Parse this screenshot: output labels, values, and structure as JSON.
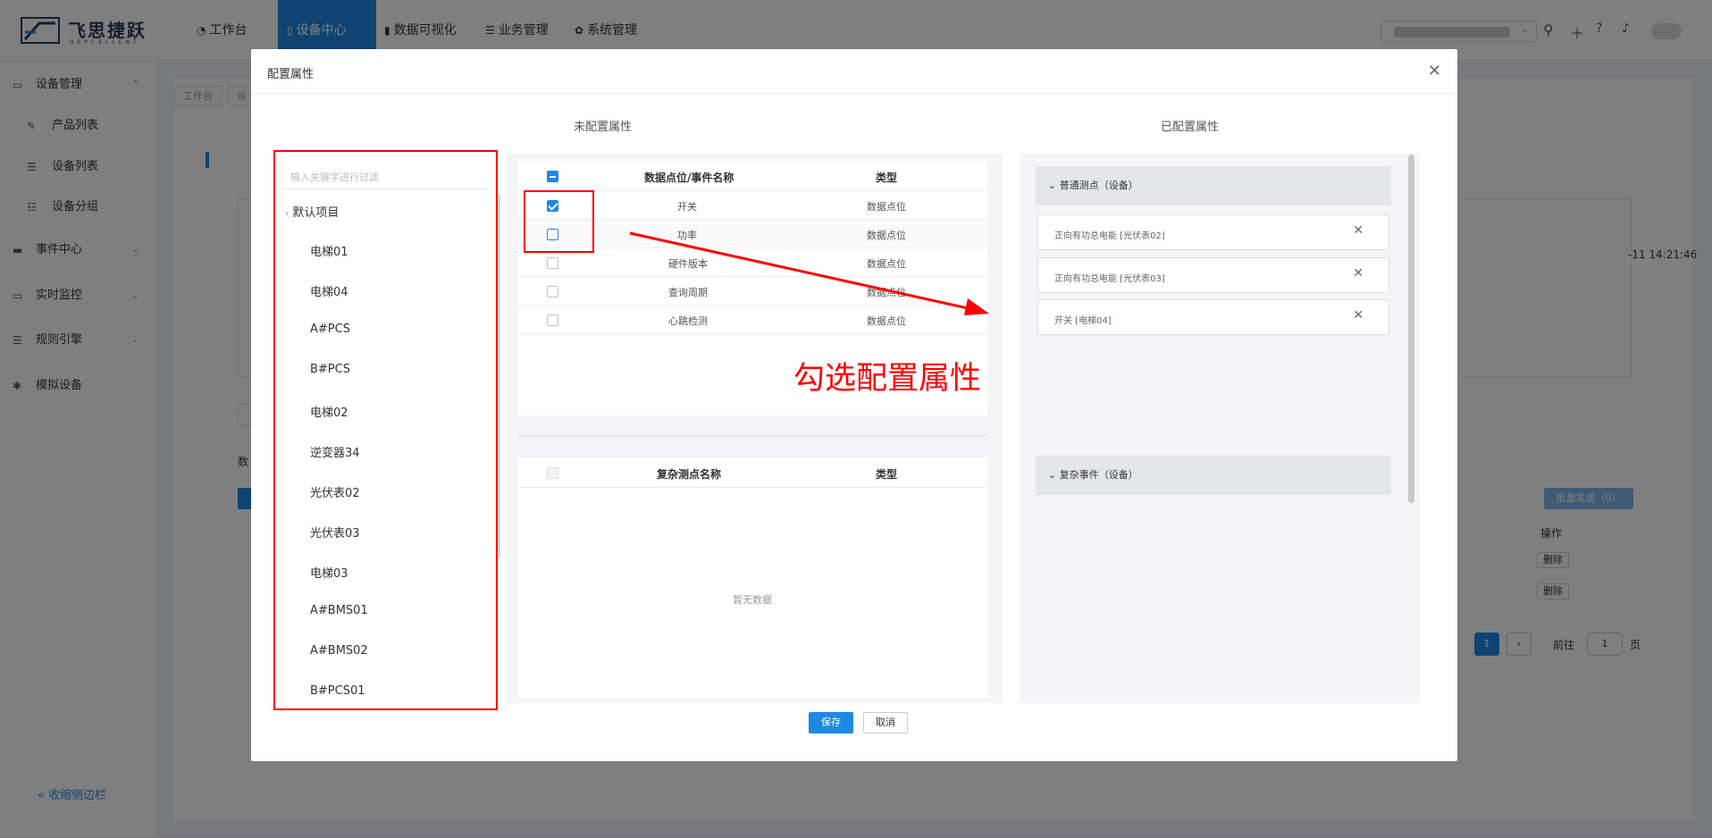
{
  "app": {
    "logo_name": "飞思捷跃",
    "logo_sub": "DEPCELLENT",
    "nav": [
      {
        "label": "工作台",
        "icon": "dashboard-icon"
      },
      {
        "label": "设备中心",
        "icon": "device-icon"
      },
      {
        "label": "数据可视化",
        "icon": "chart-icon"
      },
      {
        "label": "业务管理",
        "icon": "list-icon"
      },
      {
        "label": "系统管理",
        "icon": "gear-icon"
      }
    ],
    "active_nav": "设备中心"
  },
  "sidebar": {
    "items": [
      {
        "label": "设备管理",
        "icon": "monitor-icon",
        "arrow": "⌃"
      },
      {
        "label": "产品列表",
        "icon": "edit-icon"
      },
      {
        "label": "设备列表",
        "icon": "list-icon"
      },
      {
        "label": "设备分组",
        "icon": "group-icon"
      },
      {
        "label": "事件中心",
        "icon": "message-icon",
        "arrow": "⌄"
      },
      {
        "label": "实时监控",
        "icon": "monitor-icon",
        "arrow": "⌄"
      },
      {
        "label": "规则引擎",
        "icon": "rule-icon",
        "arrow": "⌄"
      },
      {
        "label": "模拟设备",
        "icon": "bug-icon"
      }
    ],
    "collapse_label": "收缩侧边栏"
  },
  "background": {
    "tab1": "工作台",
    "tab2": "设",
    "timestamp": "-11 14:21:46",
    "tab_partial": "数",
    "batch_send": "批量发送（0）",
    "ops_header": "操作",
    "delete1": "删除",
    "delete2": "删除",
    "page_current": "1",
    "goto_label": "前往",
    "goto_value": "1",
    "page_suffix": "页"
  },
  "dialog": {
    "title": "配置属性",
    "unconfigured_title": "未配置属性",
    "configured_title": "已配置属性",
    "search_placeholder": "输入关键字进行过滤",
    "tree_root": "默认项目",
    "tree_items": [
      "电梯01",
      "电梯04",
      "A#PCS",
      "B#PCS",
      "电梯02",
      "逆变器34",
      "光伏表02",
      "光伏表03",
      "电梯03",
      "A#BMS01",
      "A#BMS02",
      "B#PCS01"
    ],
    "table1": {
      "headers": [
        "数据点位/事件名称",
        "类型"
      ],
      "rows": [
        {
          "name": "开关",
          "type": "数据点位",
          "checked": true
        },
        {
          "name": "功率",
          "type": "数据点位",
          "checked": false
        },
        {
          "name": "硬件版本",
          "type": "数据点位",
          "checked": false
        },
        {
          "name": "查询周期",
          "type": "数据点位",
          "checked": false
        },
        {
          "name": "心跳检测",
          "type": "数据点位",
          "checked": false
        }
      ]
    },
    "table2": {
      "headers": [
        "复杂测点名称",
        "类型"
      ],
      "empty": "暂无数据"
    },
    "group1_label": "普通测点（设备）",
    "configured": [
      "正向有功总电能 [光伏表02]",
      "正向有功总电能 [光伏表03]",
      "开关 [电梯04]"
    ],
    "group2_label": "复杂事件（设备）",
    "save": "保存",
    "cancel": "取消"
  },
  "annotation": {
    "text": "勾选配置属性",
    "color": "#ff0000"
  },
  "colors": {
    "accent": "#1e88e5",
    "annotation": "#ff0000"
  }
}
